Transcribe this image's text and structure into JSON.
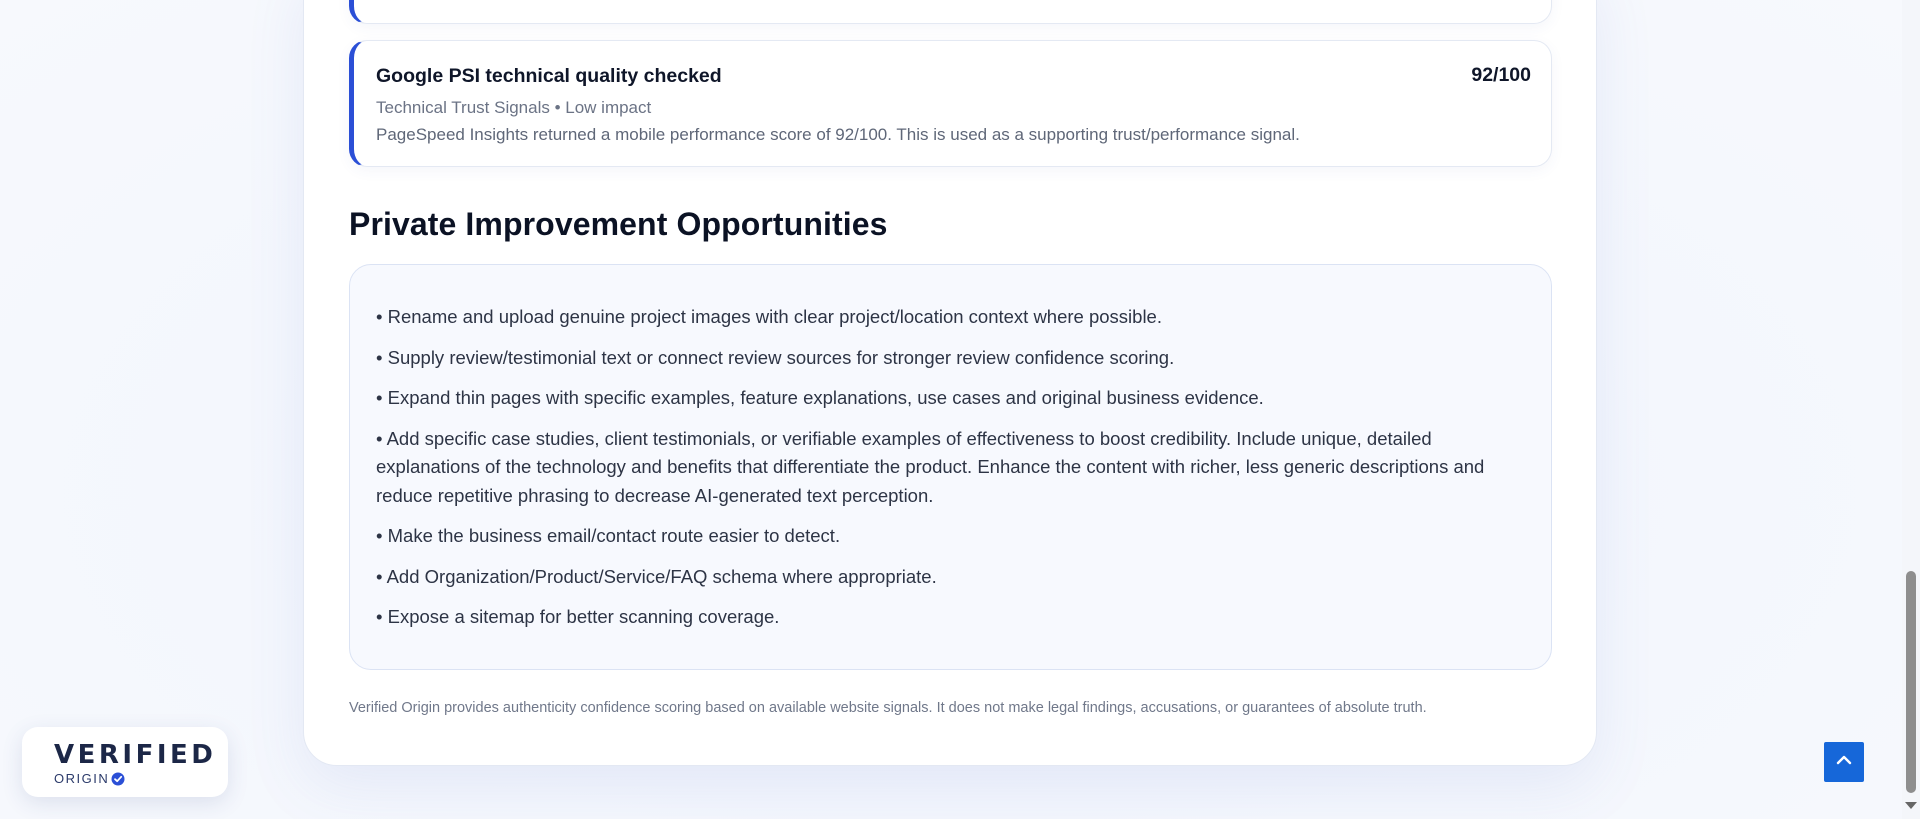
{
  "signals": {
    "psi": {
      "title": "Google PSI technical quality checked",
      "score": "92/100",
      "meta": "Technical Trust Signals • Low impact",
      "description": "PageSpeed Insights returned a mobile performance score of 92/100. This is used as a supporting trust/performance signal."
    }
  },
  "improvements": {
    "heading": "Private Improvement Opportunities",
    "items": [
      "• Rename and upload genuine project images with clear project/location context where possible.",
      "• Supply review/testimonial text or connect review sources for stronger review confidence scoring.",
      "• Expand thin pages with specific examples, feature explanations, use cases and original business evidence.",
      "• Add specific case studies, client testimonials, or verifiable examples of effectiveness to boost credibility. Include unique, detailed explanations of the technology and benefits that differentiate the product. Enhance the content with richer, less generic descriptions and reduce repetitive phrasing to decrease AI-generated text perception.",
      "• Make the business email/contact route easier to detect.",
      "• Add Organization/Product/Service/FAQ schema where appropriate.",
      "• Expose a sitemap for better scanning coverage."
    ]
  },
  "footer": {
    "disclaimer": "Verified Origin provides authenticity confidence scoring based on available website signals. It does not make legal findings, accusations, or guarantees of absolute truth."
  },
  "logo": {
    "main": "VERIFIED",
    "sub": "ORIGIN",
    "icon": "check-badge-icon"
  },
  "controls": {
    "scroll_top_icon": "chevron-up-icon"
  },
  "colors": {
    "accent": "#2b4fd6",
    "button": "#1667d9",
    "heading": "#0b1224"
  }
}
